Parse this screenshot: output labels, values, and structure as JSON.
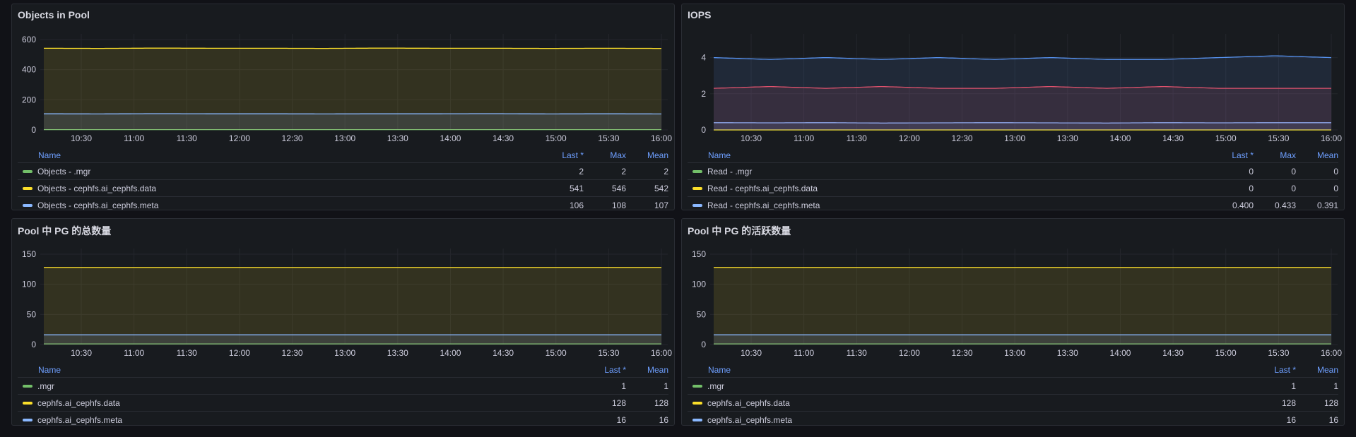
{
  "panels": [
    {
      "title": "Objects in Pool",
      "y_ticks": [
        "600",
        "400",
        "200",
        "0"
      ],
      "x_ticks": [
        "10:30",
        "11:00",
        "11:30",
        "12:00",
        "12:30",
        "13:00",
        "13:30",
        "14:00",
        "14:30",
        "15:00",
        "15:30",
        "16:00"
      ],
      "legend_headers": [
        "Name",
        "Last *",
        "Max",
        "Mean"
      ],
      "legend_rows": [
        {
          "name": "Objects - .mgr",
          "color": "#73bf69",
          "values": [
            "2",
            "2",
            "2"
          ]
        },
        {
          "name": "Objects - cephfs.ai_cephfs.data",
          "color": "#fade2a",
          "values": [
            "541",
            "546",
            "542"
          ]
        },
        {
          "name": "Objects - cephfs.ai_cephfs.meta",
          "color": "#8ab8ff",
          "values": [
            "106",
            "108",
            "107"
          ]
        }
      ]
    },
    {
      "title": "IOPS",
      "y_ticks": [
        "4",
        "2",
        "0"
      ],
      "x_ticks": [
        "10:30",
        "11:00",
        "11:30",
        "12:00",
        "12:30",
        "13:00",
        "13:30",
        "14:00",
        "14:30",
        "15:00",
        "15:30",
        "16:00"
      ],
      "legend_headers": [
        "Name",
        "Last *",
        "Max",
        "Mean"
      ],
      "legend_rows": [
        {
          "name": "Read - .mgr",
          "color": "#73bf69",
          "values": [
            "0",
            "0",
            "0"
          ]
        },
        {
          "name": "Read - cephfs.ai_cephfs.data",
          "color": "#fade2a",
          "values": [
            "0",
            "0",
            "0"
          ]
        },
        {
          "name": "Read - cephfs.ai_cephfs.meta",
          "color": "#8ab8ff",
          "values": [
            "0.400",
            "0.433",
            "0.391"
          ]
        }
      ]
    },
    {
      "title": "Pool 中 PG 的总数量",
      "y_ticks": [
        "150",
        "100",
        "50",
        "0"
      ],
      "x_ticks": [
        "10:30",
        "11:00",
        "11:30",
        "12:00",
        "12:30",
        "13:00",
        "13:30",
        "14:00",
        "14:30",
        "15:00",
        "15:30",
        "16:00"
      ],
      "legend_headers": [
        "Name",
        "Last *",
        "Mean"
      ],
      "legend_rows": [
        {
          "name": ".mgr",
          "color": "#73bf69",
          "values": [
            "1",
            "1"
          ]
        },
        {
          "name": "cephfs.ai_cephfs.data",
          "color": "#fade2a",
          "values": [
            "128",
            "128"
          ]
        },
        {
          "name": "cephfs.ai_cephfs.meta",
          "color": "#8ab8ff",
          "values": [
            "16",
            "16"
          ]
        }
      ]
    },
    {
      "title": "Pool 中 PG 的活跃数量",
      "y_ticks": [
        "150",
        "100",
        "50",
        "0"
      ],
      "x_ticks": [
        "10:30",
        "11:00",
        "11:30",
        "12:00",
        "12:30",
        "13:00",
        "13:30",
        "14:00",
        "14:30",
        "15:00",
        "15:30",
        "16:00"
      ],
      "legend_headers": [
        "Name",
        "Last *",
        "Mean"
      ],
      "legend_rows": [
        {
          "name": ".mgr",
          "color": "#73bf69",
          "values": [
            "1",
            "1"
          ]
        },
        {
          "name": "cephfs.ai_cephfs.data",
          "color": "#fade2a",
          "values": [
            "128",
            "128"
          ]
        },
        {
          "name": "cephfs.ai_cephfs.meta",
          "color": "#8ab8ff",
          "values": [
            "16",
            "16"
          ]
        }
      ]
    }
  ],
  "chart_data": [
    {
      "type": "line",
      "title": "Objects in Pool",
      "ylim": [
        0,
        600
      ],
      "x": [
        "10:30",
        "11:00",
        "11:30",
        "12:00",
        "12:30",
        "13:00",
        "13:30",
        "14:00",
        "14:30",
        "15:00",
        "15:30",
        "16:00"
      ],
      "series": [
        {
          "name": "Objects - .mgr",
          "color": "#73bf69",
          "values": [
            2,
            2,
            2,
            2,
            2,
            2,
            2,
            2,
            2,
            2,
            2,
            2
          ]
        },
        {
          "name": "Objects - cephfs.ai_cephfs.data",
          "color": "#fade2a",
          "values": [
            542,
            541,
            543,
            542,
            542,
            541,
            543,
            542,
            542,
            541,
            542,
            541
          ]
        },
        {
          "name": "Objects - cephfs.ai_cephfs.meta",
          "color": "#8ab8ff",
          "values": [
            107,
            106,
            108,
            107,
            107,
            106,
            107,
            107,
            108,
            106,
            107,
            106
          ]
        }
      ]
    },
    {
      "type": "line",
      "title": "IOPS",
      "ylim": [
        0,
        5
      ],
      "x": [
        "10:30",
        "11:00",
        "11:30",
        "12:00",
        "12:30",
        "13:00",
        "13:30",
        "14:00",
        "14:30",
        "15:00",
        "15:30",
        "16:00"
      ],
      "series": [
        {
          "name": "Read - .mgr",
          "color": "#73bf69",
          "values": [
            0,
            0,
            0,
            0,
            0,
            0,
            0,
            0,
            0,
            0,
            0,
            0
          ]
        },
        {
          "name": "Read - cephfs.ai_cephfs.data",
          "color": "#fade2a",
          "values": [
            0,
            0,
            0,
            0,
            0,
            0,
            0,
            0,
            0,
            0,
            0,
            0
          ]
        },
        {
          "name": "Read - cephfs.ai_cephfs.meta",
          "color": "#8ab8ff",
          "values": [
            0.4,
            0.39,
            0.4,
            0.38,
            0.39,
            0.4,
            0.39,
            0.38,
            0.4,
            0.39,
            0.4,
            0.4
          ]
        },
        {
          "name": "",
          "color": "#f2495c",
          "values": [
            2.3,
            2.4,
            2.3,
            2.4,
            2.3,
            2.3,
            2.4,
            2.3,
            2.4,
            2.3,
            2.3,
            2.3
          ]
        },
        {
          "name": "",
          "color": "#5794f2",
          "values": [
            4.0,
            3.9,
            4.0,
            3.9,
            4.0,
            3.9,
            4.0,
            3.9,
            3.9,
            4.0,
            4.1,
            4.0
          ]
        }
      ]
    },
    {
      "type": "line",
      "title": "Pool 中 PG 的总数量",
      "ylim": [
        0,
        150
      ],
      "x": [
        "10:30",
        "11:00",
        "11:30",
        "12:00",
        "12:30",
        "13:00",
        "13:30",
        "14:00",
        "14:30",
        "15:00",
        "15:30",
        "16:00"
      ],
      "series": [
        {
          "name": ".mgr",
          "color": "#73bf69",
          "values": [
            1,
            1,
            1,
            1,
            1,
            1,
            1,
            1,
            1,
            1,
            1,
            1
          ]
        },
        {
          "name": "cephfs.ai_cephfs.data",
          "color": "#fade2a",
          "values": [
            128,
            128,
            128,
            128,
            128,
            128,
            128,
            128,
            128,
            128,
            128,
            128
          ]
        },
        {
          "name": "cephfs.ai_cephfs.meta",
          "color": "#8ab8ff",
          "values": [
            16,
            16,
            16,
            16,
            16,
            16,
            16,
            16,
            16,
            16,
            16,
            16
          ]
        }
      ]
    },
    {
      "type": "line",
      "title": "Pool 中 PG 的活跃数量",
      "ylim": [
        0,
        150
      ],
      "x": [
        "10:30",
        "11:00",
        "11:30",
        "12:00",
        "12:30",
        "13:00",
        "13:30",
        "14:00",
        "14:30",
        "15:00",
        "15:30",
        "16:00"
      ],
      "series": [
        {
          "name": ".mgr",
          "color": "#73bf69",
          "values": [
            1,
            1,
            1,
            1,
            1,
            1,
            1,
            1,
            1,
            1,
            1,
            1
          ]
        },
        {
          "name": "cephfs.ai_cephfs.data",
          "color": "#fade2a",
          "values": [
            128,
            128,
            128,
            128,
            128,
            128,
            128,
            128,
            128,
            128,
            128,
            128
          ]
        },
        {
          "name": "cephfs.ai_cephfs.meta",
          "color": "#8ab8ff",
          "values": [
            16,
            16,
            16,
            16,
            16,
            16,
            16,
            16,
            16,
            16,
            16,
            16
          ]
        }
      ]
    }
  ]
}
